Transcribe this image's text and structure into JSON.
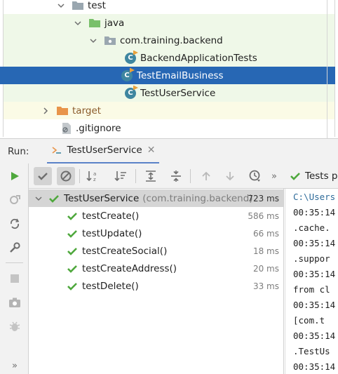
{
  "tree": {
    "rows": [
      {
        "label": "test",
        "icon": "folder-icon"
      },
      {
        "label": "java",
        "icon": "source-folder-icon"
      },
      {
        "label": "com.training.backend",
        "icon": "package-icon"
      },
      {
        "label": "BackendApplicationTests",
        "icon": "test-class-icon"
      },
      {
        "label": "TestEmailBusiness",
        "icon": "test-class-icon"
      },
      {
        "label": "TestUserService",
        "icon": "test-class-icon"
      },
      {
        "label": "target",
        "icon": "excluded-folder-icon"
      },
      {
        "label": ".gitignore",
        "icon": "ignore-file-icon"
      }
    ]
  },
  "run": {
    "label": "Run:",
    "tab_label": "TestUserService",
    "status": "Tests pa"
  },
  "results": {
    "root": {
      "name": "TestUserService",
      "package": "(com.training.backend)",
      "time": "723 ms"
    },
    "tests": [
      {
        "name": "testCreate()",
        "time": "586 ms"
      },
      {
        "name": "testUpdate()",
        "time": "66 ms"
      },
      {
        "name": "testCreateSocial()",
        "time": "18 ms"
      },
      {
        "name": "testCreateAddress()",
        "time": "20 ms"
      },
      {
        "name": "testDelete()",
        "time": "33 ms"
      }
    ]
  },
  "console": {
    "lines": [
      "C:\\Users",
      "00:35:14",
      " .cache.",
      "00:35:14",
      " .suppor",
      "00:35:14",
      " from cl",
      "00:35:14",
      "  [com.t",
      "00:35:14",
      " .TestUs",
      "00:35:14"
    ]
  },
  "colors": {
    "selection": "#2767b4",
    "pass_green": "#4fa83d",
    "folder_orange": "#e8944a",
    "source_green": "#79c06a",
    "class_teal": "#3e86a0"
  }
}
